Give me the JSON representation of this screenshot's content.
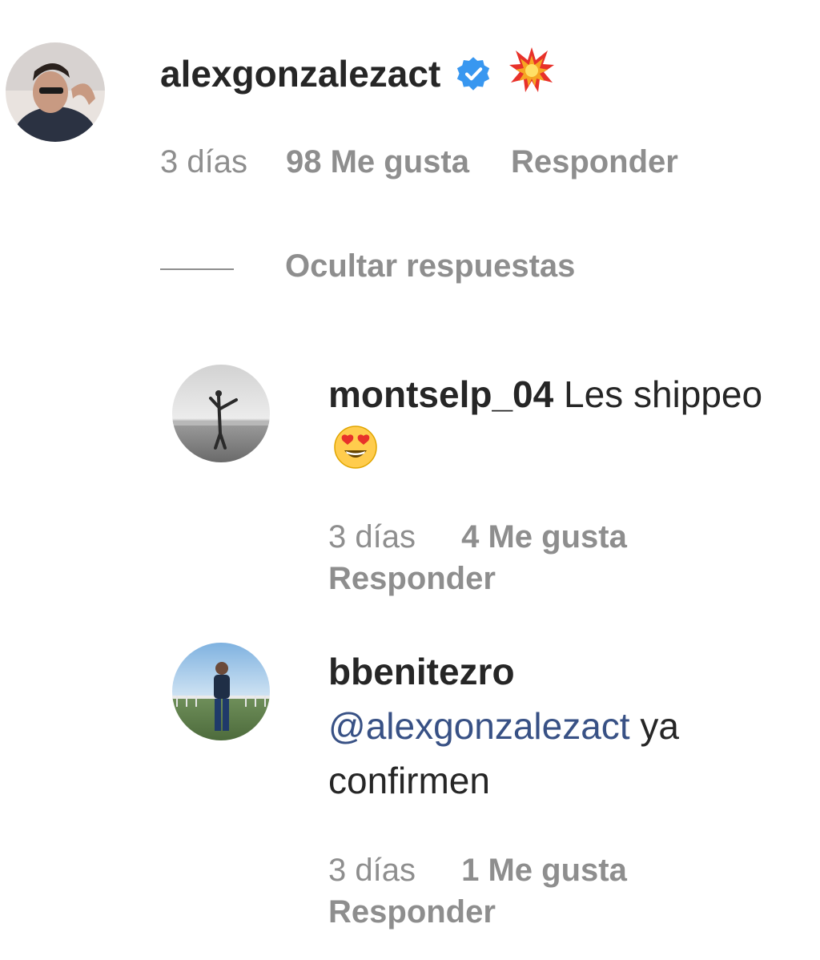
{
  "comment": {
    "username": "alexgonzalezact",
    "text": "💥",
    "verified": true,
    "time": "3 días",
    "likes": "98 Me gusta",
    "reply_label": "Responder"
  },
  "hide_replies_label": "Ocultar respuestas",
  "replies": [
    {
      "username": "montselp_04",
      "text": "Les shippeo",
      "emoji": "heart-eyes-emoji",
      "time": "3 días",
      "likes": "4 Me gusta",
      "reply_label": "Responder"
    },
    {
      "username": "bbenitezro",
      "mention": "@alexgonzalezact",
      "text": "ya confirmen",
      "time": "3 días",
      "likes": "1 Me gusta",
      "reply_label": "Responder"
    }
  ],
  "colors": {
    "text": "#262626",
    "secondary": "#8e8e8e",
    "mention": "#385185",
    "verified": "#3897f0"
  }
}
